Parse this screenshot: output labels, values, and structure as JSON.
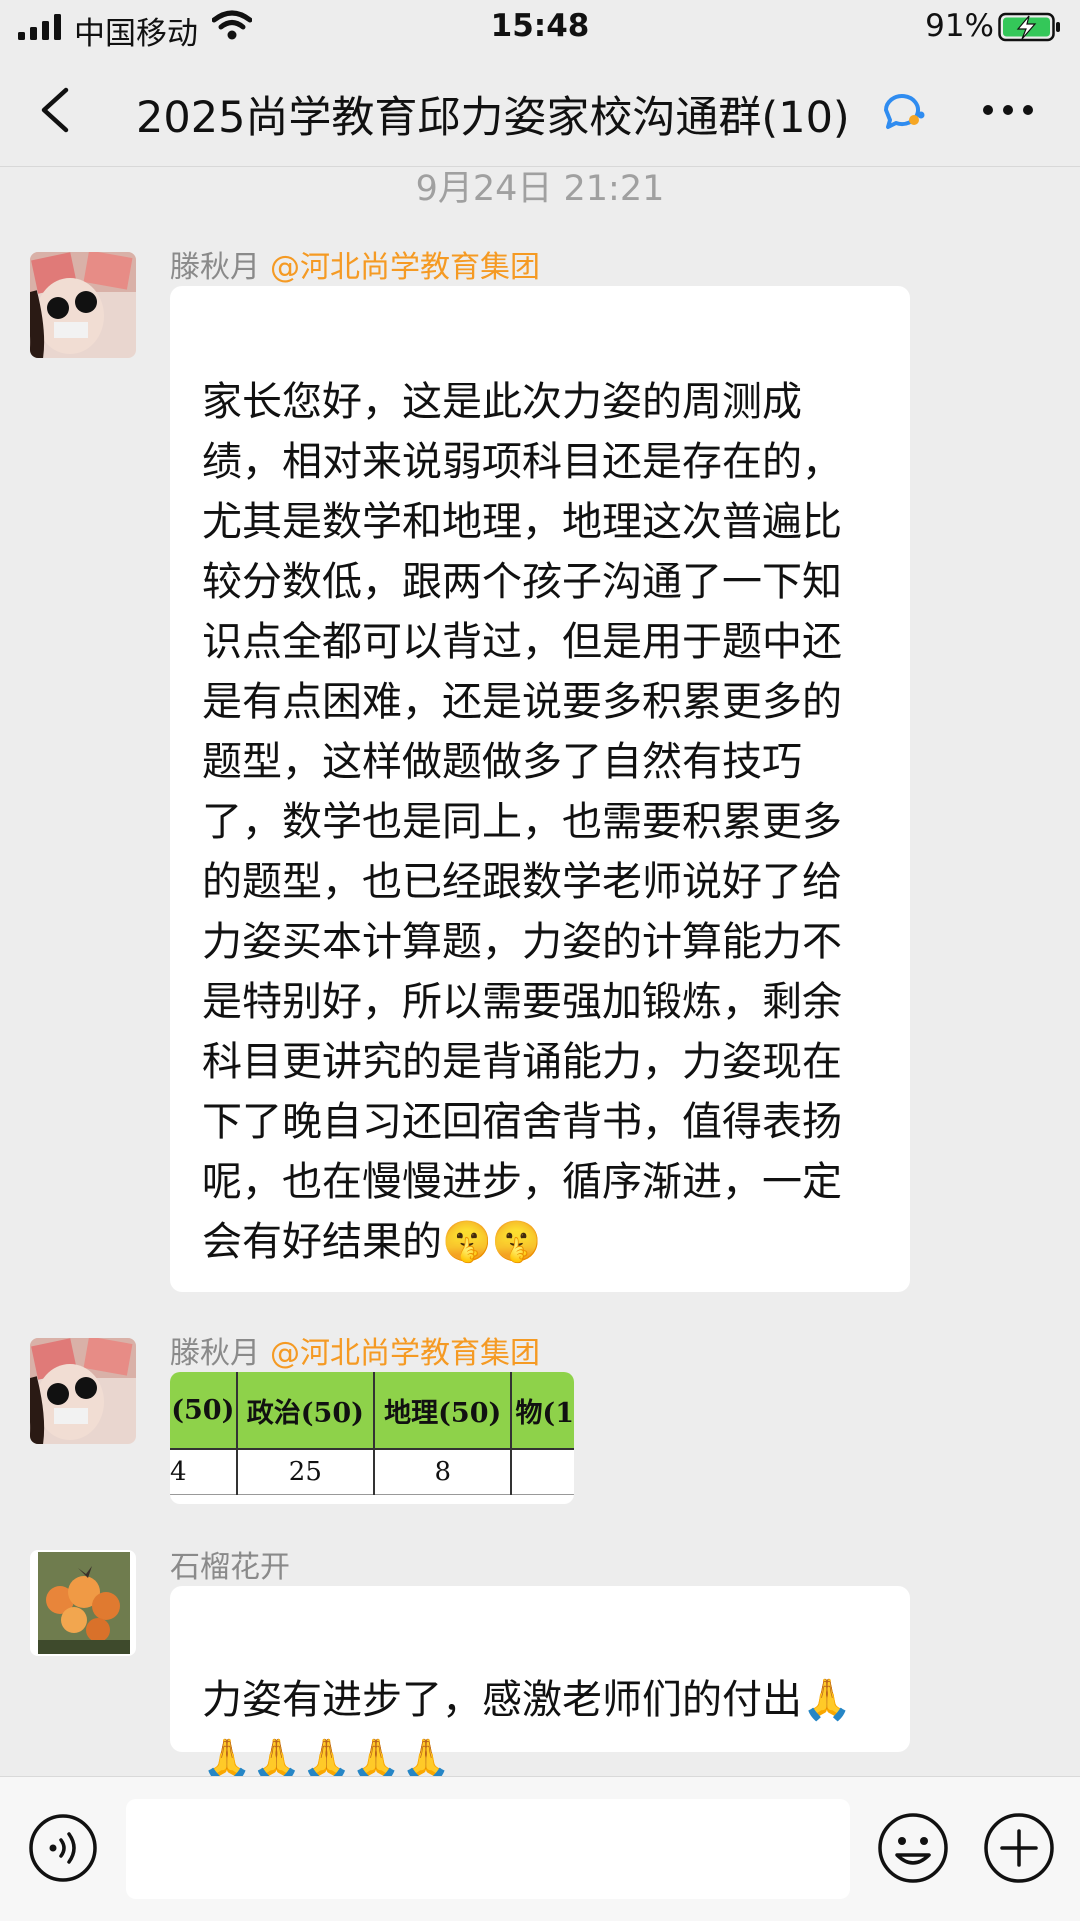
{
  "status": {
    "carrier": "中国移动",
    "time": "15:48",
    "battery": "91%"
  },
  "nav": {
    "title": "2025尚学教育邱力姿家校沟通群(10)"
  },
  "chat": {
    "timestamp": "9月24日 21:21",
    "messages": [
      {
        "sender": "滕秋月",
        "tag": "@河北尚学教育集团",
        "text": "家长您好，这是此次力姿的周测成绩，相对来说弱项科目还是存在的，尤其是数学和地理，地理这次普遍比较分数低，跟两个孩子沟通了一下知识点全都可以背过，但是用于题中还是有点困难，还是说要多积累更多的题型，这样做题做多了自然有技巧了，数学也是同上，也需要积累更多的题型，也已经跟数学老师说好了给力姿买本计算题，力姿的计算能力不是特别好，所以需要强加锻炼，剩余科目更讲究的是背诵能力，力姿现在下了晚自习还回宿舍背书，值得表扬呢，也在慢慢进步，循序渐进，一定会有好结果的🤫🤫"
      },
      {
        "sender": "滕秋月",
        "tag": "@河北尚学教育集团",
        "table": {
          "headers": [
            "(50)",
            "政治(50)",
            "地理(50)",
            "物(1"
          ],
          "row": [
            "4",
            "25",
            "8",
            ""
          ]
        }
      },
      {
        "sender": "石榴花开",
        "text": "力姿有进步了，感激老师们的付出🙏🙏🙏🙏🙏🙏"
      }
    ]
  },
  "colors": {
    "background": "#ededed",
    "tag": "#f59a23",
    "table_header": "#8ed24a"
  }
}
